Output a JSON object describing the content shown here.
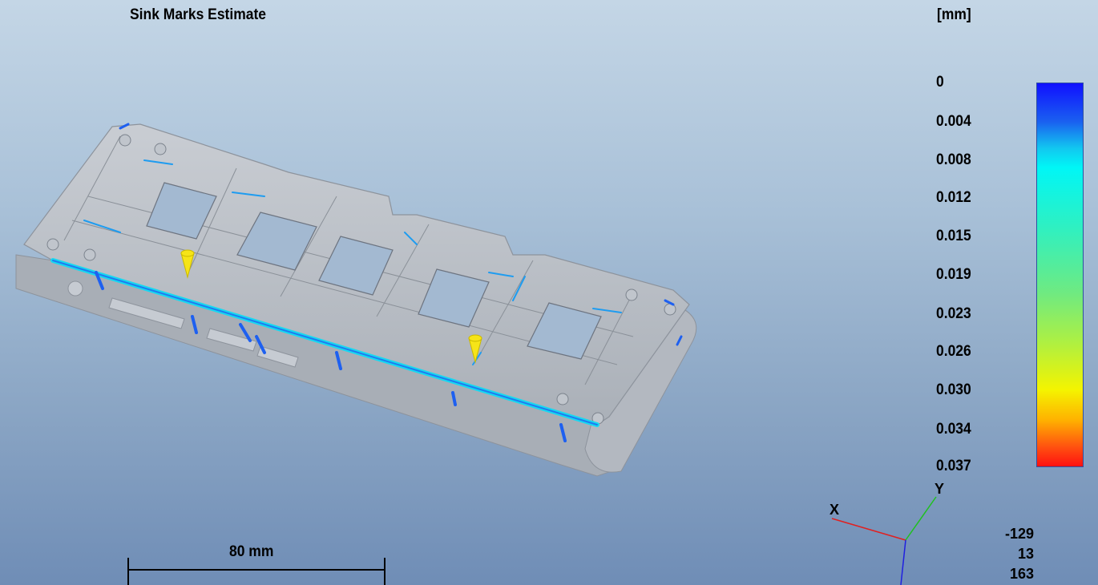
{
  "title": "Sink Marks Estimate",
  "legend": {
    "unit": "[mm]",
    "labels": [
      "0",
      "0.004",
      "0.008",
      "0.012",
      "0.015",
      "0.019",
      "0.023",
      "0.026",
      "0.030",
      "0.034",
      "0.037"
    ],
    "colormap": [
      "#1010ff",
      "#00f6f6",
      "#70ea80",
      "#f4f400",
      "#ff1010"
    ]
  },
  "scale_bar": {
    "label": "80 mm"
  },
  "axes": {
    "x_label": "X",
    "y_label": "Y",
    "x_color": "#e02020",
    "y_color": "#20c020",
    "z_color": "#2020e0"
  },
  "coordinates": [
    "-129",
    "13",
    "163"
  ],
  "model": {
    "part_color": "#b7bcc4",
    "sink_color": "#1e7cf0",
    "gate_color": "#f6e418"
  }
}
